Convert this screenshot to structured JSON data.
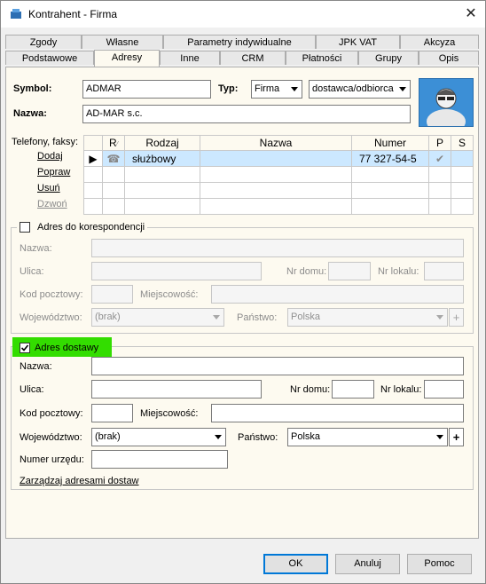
{
  "window": {
    "title": "Kontrahent - Firma"
  },
  "tabs_row1": [
    "Zgody",
    "Własne",
    "Parametry indywidualne",
    "JPK VAT",
    "Akcyza"
  ],
  "tabs_row2": [
    "Podstawowe",
    "Adresy",
    "Inne",
    "CRM",
    "Płatności",
    "Grupy",
    "Opis"
  ],
  "active_tab": "Adresy",
  "header": {
    "symbol_label": "Symbol:",
    "symbol_value": "ADMAR",
    "typ_label": "Typ:",
    "typ_value": "Firma",
    "role_value": "dostawca/odbiorca",
    "nazwa_label": "Nazwa:",
    "nazwa_value": "AD-MAR s.c."
  },
  "phones": {
    "label": "Telefony, faksy:",
    "actions": [
      "Dodaj",
      "Popraw",
      "Usuń",
      "Dzwoń"
    ],
    "columns": [
      "R",
      "Rodzaj",
      "Nazwa",
      "Numer",
      "P",
      "S"
    ],
    "rows": [
      {
        "rodzaj": "służbowy",
        "nazwa": "",
        "numer": "77 327-54-5",
        "p": "✔"
      }
    ]
  },
  "korespondencja": {
    "checkbox_label": "Adres do korespondencji",
    "checked": false,
    "nazwa_label": "Nazwa:",
    "ulica_label": "Ulica:",
    "nr_domu_label": "Nr domu:",
    "nr_lokalu_label": "Nr lokalu:",
    "kod_label": "Kod pocztowy:",
    "miejscowosc_label": "Miejscowość:",
    "wojewodztwo_label": "Województwo:",
    "wojewodztwo_value": "(brak)",
    "panstwo_label": "Państwo:",
    "panstwo_value": "Polska"
  },
  "dostawa": {
    "checkbox_label": "Adres dostawy",
    "checked": true,
    "nazwa_label": "Nazwa:",
    "ulica_label": "Ulica:",
    "nr_domu_label": "Nr domu:",
    "nr_lokalu_label": "Nr lokalu:",
    "kod_label": "Kod pocztowy:",
    "miejscowosc_label": "Miejscowość:",
    "wojewodztwo_label": "Województwo:",
    "wojewodztwo_value": "(brak)",
    "panstwo_label": "Państwo:",
    "panstwo_value": "Polska",
    "numer_urzedu_label": "Numer urzędu:",
    "manage_link": "Zarządzaj adresami dostaw"
  },
  "buttons": {
    "ok": "OK",
    "cancel": "Anuluj",
    "help": "Pomoc"
  },
  "colors": {
    "panel_bg": "#fdfaf0",
    "highlight": "#33dd00",
    "selected_row": "#cce8ff"
  }
}
